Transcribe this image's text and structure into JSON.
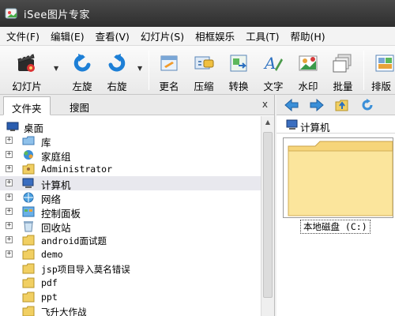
{
  "window": {
    "title": "iSee图片专家"
  },
  "menu": [
    "文件(F)",
    "编辑(E)",
    "查看(V)",
    "幻灯片(S)",
    "相框娱乐",
    "工具(T)",
    "帮助(H)"
  ],
  "toolbar": {
    "slideshow": "幻灯片",
    "rotate_left": "左旋",
    "rotate_right": "右旋",
    "rename": "更名",
    "compress": "压缩",
    "convert": "转换",
    "text": "文字",
    "watermark": "水印",
    "batch": "批量",
    "layout": "排版"
  },
  "left_panel": {
    "tabs": [
      "文件夹",
      "搜图"
    ],
    "close": "x",
    "tree": [
      {
        "label": "桌面",
        "icon": "desktop-icon",
        "expander": "",
        "mono": false
      },
      {
        "label": "库",
        "icon": "library-icon",
        "expander": "+",
        "mono": false
      },
      {
        "label": "家庭组",
        "icon": "homegroup-icon",
        "expander": "+",
        "mono": false
      },
      {
        "label": "Administrator",
        "icon": "user-folder-icon",
        "expander": "+",
        "mono": true
      },
      {
        "label": "计算机",
        "icon": "computer-icon",
        "expander": "+",
        "mono": false
      },
      {
        "label": "网络",
        "icon": "network-icon",
        "expander": "+",
        "mono": false
      },
      {
        "label": "控制面板",
        "icon": "control-panel-icon",
        "expander": "+",
        "mono": false
      },
      {
        "label": "回收站",
        "icon": "recycle-bin-icon",
        "expander": "+",
        "mono": false
      },
      {
        "label": "android面试题",
        "icon": "folder-icon",
        "expander": "+",
        "mono": true
      },
      {
        "label": "demo",
        "icon": "folder-icon",
        "expander": "+",
        "mono": true
      },
      {
        "label": "jsp项目导入莫名错误",
        "icon": "folder-icon",
        "expander": "",
        "mono": true
      },
      {
        "label": "pdf",
        "icon": "folder-icon",
        "expander": "",
        "mono": true
      },
      {
        "label": "ppt",
        "icon": "folder-icon",
        "expander": "",
        "mono": true
      },
      {
        "label": "飞升大作战",
        "icon": "folder-icon",
        "expander": "",
        "mono": true
      }
    ]
  },
  "right_panel": {
    "path": "计算机",
    "item_label": "本地磁盘 (C:)"
  }
}
